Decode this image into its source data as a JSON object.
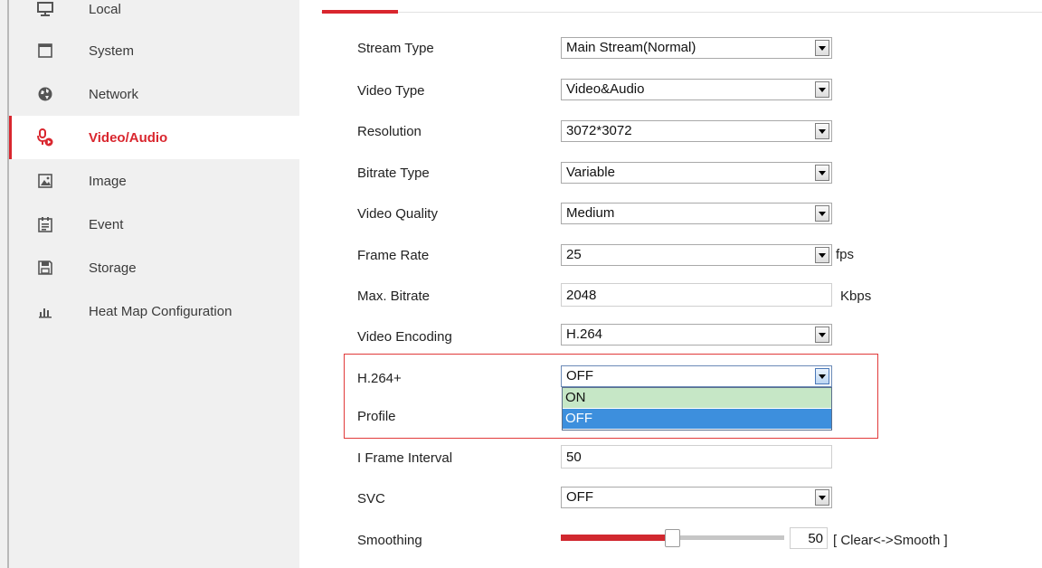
{
  "sidebar": {
    "items": [
      {
        "label": "Local",
        "icon": "monitor-icon",
        "active": false
      },
      {
        "label": "System",
        "icon": "window-icon",
        "active": false
      },
      {
        "label": "Network",
        "icon": "globe-icon",
        "active": false
      },
      {
        "label": "Video/Audio",
        "icon": "video-audio-icon",
        "active": true
      },
      {
        "label": "Image",
        "icon": "image-icon",
        "active": false
      },
      {
        "label": "Event",
        "icon": "calendar-icon",
        "active": false
      },
      {
        "label": "Storage",
        "icon": "floppy-disk-icon",
        "active": false
      },
      {
        "label": "Heat Map Configuration",
        "icon": "bar-chart-icon",
        "active": false
      }
    ]
  },
  "form": {
    "stream_type": {
      "label": "Stream Type",
      "value": "Main Stream(Normal)"
    },
    "video_type": {
      "label": "Video Type",
      "value": "Video&Audio"
    },
    "resolution": {
      "label": "Resolution",
      "value": "3072*3072"
    },
    "bitrate_type": {
      "label": "Bitrate Type",
      "value": "Variable"
    },
    "video_quality": {
      "label": "Video Quality",
      "value": "Medium"
    },
    "frame_rate": {
      "label": "Frame Rate",
      "value": "25",
      "unit": "fps"
    },
    "max_bitrate": {
      "label": "Max. Bitrate",
      "value": "2048",
      "unit": "Kbps"
    },
    "video_encoding": {
      "label": "Video Encoding",
      "value": "H.264"
    },
    "h264plus": {
      "label": "H.264+",
      "value": "OFF",
      "options": [
        "ON",
        "OFF"
      ],
      "hovered": "ON",
      "selected": "OFF"
    },
    "profile": {
      "label": "Profile"
    },
    "i_frame_interval": {
      "label": "I Frame Interval",
      "value": "50"
    },
    "svc": {
      "label": "SVC",
      "value": "OFF"
    },
    "smoothing": {
      "label": "Smoothing",
      "value": "50",
      "range_label": "[ Clear<->Smooth ]",
      "level_percent": 50
    }
  },
  "colors": {
    "accent": "#d9262e",
    "highlight_box": "#e13a3a",
    "option_hover": "#c6e7c6",
    "option_selected": "#3d8fdd"
  }
}
